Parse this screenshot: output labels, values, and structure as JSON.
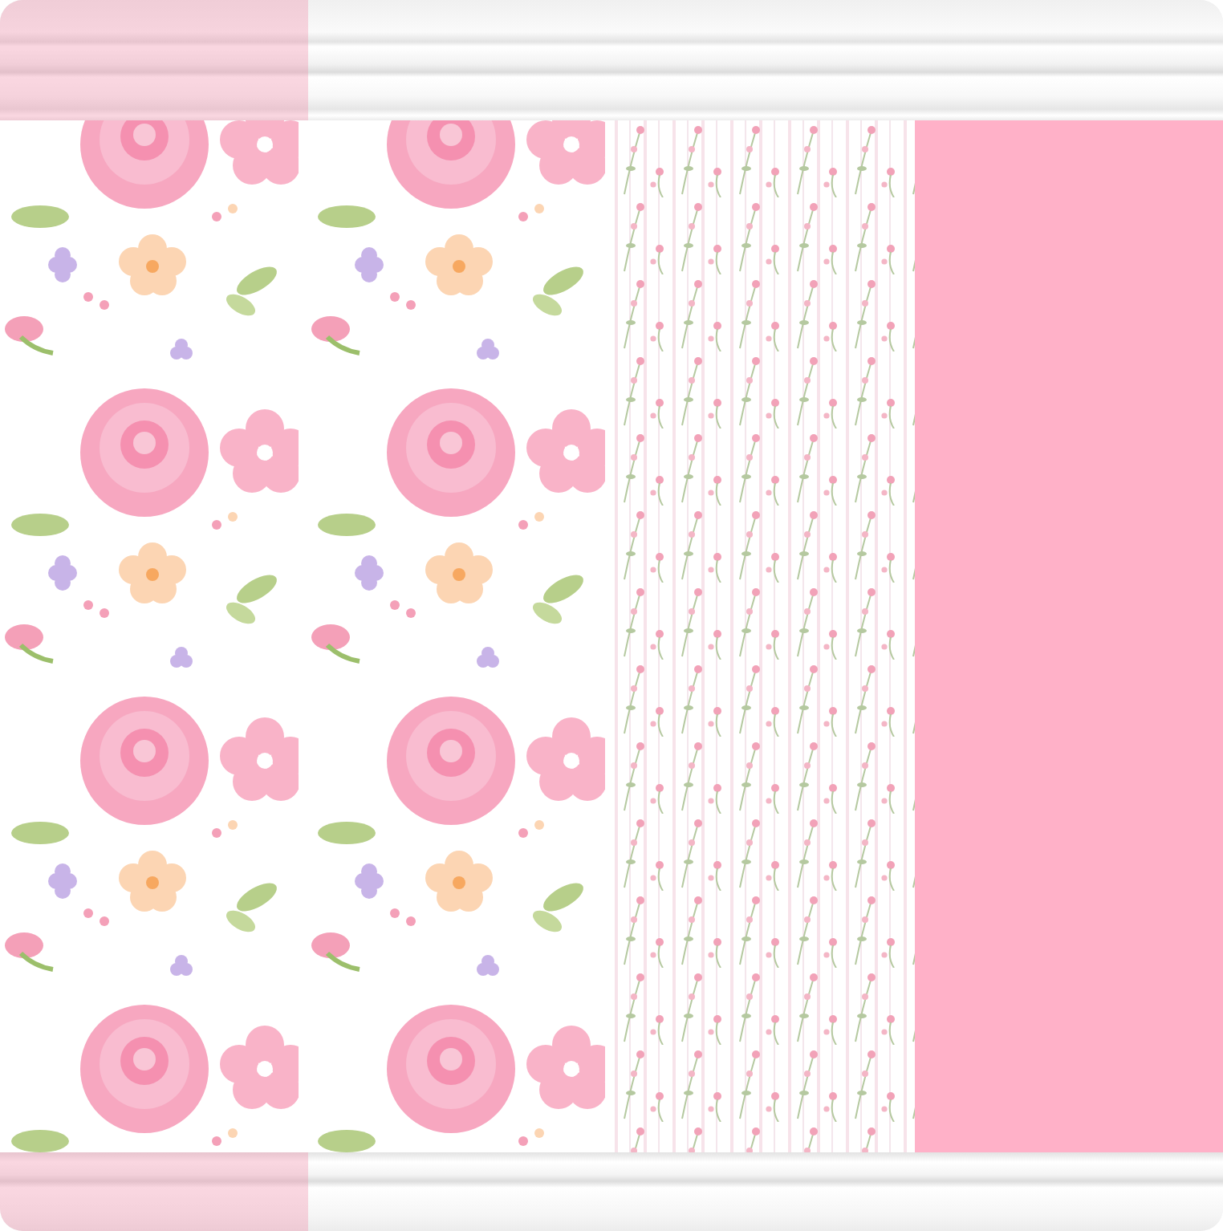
{
  "wallpapers": [
    {
      "kind": "rose-pattern",
      "selected": true
    },
    {
      "kind": "floral-stripe",
      "selected": false
    },
    {
      "kind": "solid",
      "color": "#ffb1c8",
      "selected": false
    }
  ]
}
